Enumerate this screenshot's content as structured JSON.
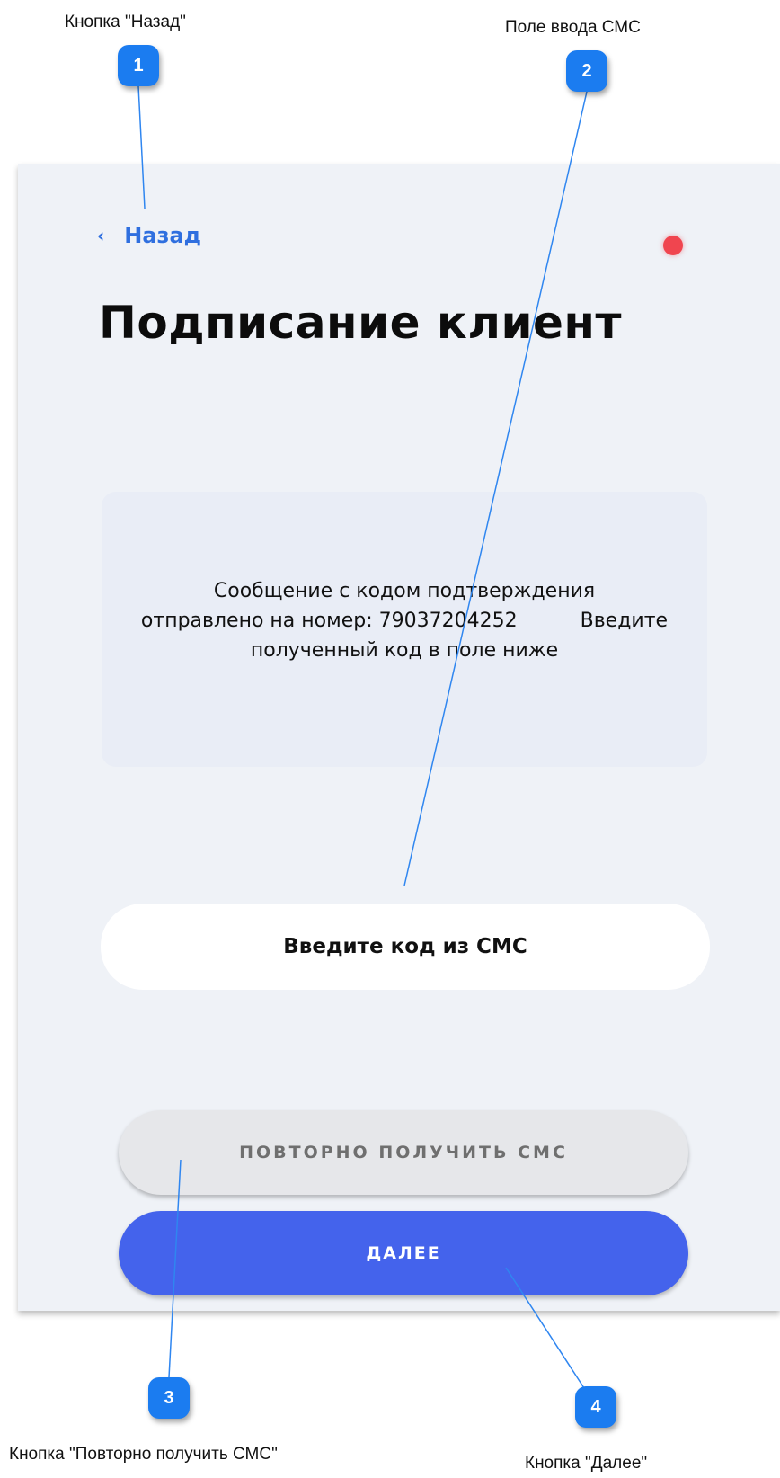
{
  "callouts": [
    {
      "number": "1",
      "label": "Кнопка \"Назад\""
    },
    {
      "number": "2",
      "label": "Поле ввода СМС"
    },
    {
      "number": "3",
      "label": "Кнопка \"Повторно получить СМС\""
    },
    {
      "number": "4",
      "label": "Кнопка \"Далее\""
    }
  ],
  "screen": {
    "back_label": "Назад",
    "back_icon": "chevron-left-icon",
    "status_color": "#f0454f",
    "title": "Подписание клиент",
    "info_line_1": "Сообщение с кодом подтверждения",
    "info_line_2": "отправлено на номер: 79037204252",
    "info_line_2b": "Введите",
    "info_line_3": "полученный код в поле ниже",
    "sms_placeholder": "Введите код из СМС",
    "resend_label": "ПОВТОРНО ПОЛУЧИТЬ СМС",
    "next_label": "ДАЛЕЕ"
  },
  "colors": {
    "accent": "#4463ec",
    "link": "#2f6fdf",
    "marker": "#1b7cf0",
    "screen_bg": "#eff2f7"
  }
}
